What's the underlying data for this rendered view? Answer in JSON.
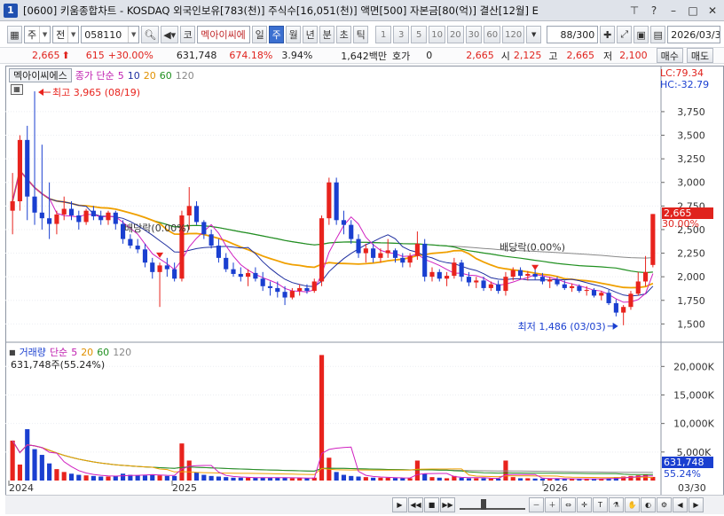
{
  "window": {
    "number": "1",
    "title": "[0600] 키움종합차트 - KOSDAQ 외국인보유[783(천)] 주식수[16,051(천)] 액면[500] 자본금[80(억)] 결산[12월] E"
  },
  "toolbar": {
    "period_select": "주",
    "prev_select": "전",
    "stock_code": "058110",
    "market_btn": "코",
    "stock_name": "멕아이씨에",
    "periods": [
      "일",
      "주",
      "월",
      "년",
      "분",
      "초",
      "틱"
    ],
    "active_period": "주",
    "intervals": [
      "1",
      "3",
      "5",
      "10",
      "20",
      "30",
      "60",
      "120"
    ],
    "count": "88/300",
    "date": "2026/03/3"
  },
  "quote": {
    "price": "2,665",
    "change": "615",
    "change_pct": "+30.00%",
    "volume": "631,748",
    "volume_pct": "674.18%",
    "turnover": "3.94%",
    "amount": "1,642백만",
    "hoga_label": "호가",
    "hoga_value": "0",
    "last": "2,665",
    "open_label": "시",
    "open": "2,125",
    "high_label": "고",
    "high": "2,665",
    "low_label": "저",
    "low": "2,100",
    "buy_btn": "매수",
    "sell_btn": "매도"
  },
  "price_panel": {
    "legend_name": "멕아이씨에스",
    "legend_ma": "종가 단순",
    "ma_periods": [
      "5",
      "10",
      "20",
      "60",
      "120"
    ],
    "lc": "LC:79.34",
    "hc": "HC:-32.79",
    "current_price_tag": "2,665",
    "current_pct_tag": "30.00%",
    "high_annot": "최고 3,965 (08/19)",
    "low_annot": "최저 1,486 (03/03)",
    "div_annot_1": "배당락(0.00%)",
    "div_annot_2": "배당락(0.00%)"
  },
  "volume_panel": {
    "legend_name": "거래량",
    "legend_ma": "단순",
    "ma_periods": [
      "5",
      "20",
      "60",
      "120"
    ],
    "volume_text": "631,748주(55.24%)",
    "current_vol_tag": "631,748",
    "current_vol_pct": "55.24%"
  },
  "x_labels": [
    "2024",
    "2025",
    "2026",
    "03/30"
  ],
  "colors": {
    "up": "#e8231d",
    "down": "#1a3fd0",
    "ma5": "#d020c0",
    "ma10": "#2030a0",
    "ma20": "#f0a000",
    "ma60": "#209020",
    "ma120": "#888888"
  },
  "chart_data": {
    "type": "candlestick",
    "price_axis": {
      "ticks": [
        "3,750",
        "3,500",
        "3,250",
        "3,000",
        "2,750",
        "2,500",
        "2,250",
        "2,000",
        "1,750",
        "1,500"
      ],
      "range": [
        1400,
        4050
      ]
    },
    "volume_axis": {
      "ticks": [
        "20,000K",
        "15,000K",
        "10,000K",
        "5,000K"
      ],
      "range": [
        0,
        23000
      ]
    },
    "candles": [
      [
        2700,
        3100,
        2450,
        2800,
        7000
      ],
      [
        2800,
        3500,
        2700,
        3450,
        2800
      ],
      [
        3450,
        3600,
        2600,
        2850,
        9000
      ],
      [
        2850,
        3965,
        2550,
        2680,
        5500
      ],
      [
        2680,
        3400,
        2500,
        2620,
        4500
      ],
      [
        2620,
        3000,
        2400,
        2560,
        3000
      ],
      [
        2560,
        2700,
        2450,
        2660,
        2000
      ],
      [
        2660,
        2850,
        2600,
        2720,
        1500
      ],
      [
        2720,
        2800,
        2600,
        2650,
        1200
      ],
      [
        2650,
        2700,
        2500,
        2580,
        1000
      ],
      [
        2580,
        2720,
        2550,
        2700,
        900
      ],
      [
        2700,
        2750,
        2600,
        2640,
        800
      ],
      [
        2640,
        2700,
        2550,
        2600,
        700
      ],
      [
        2600,
        2700,
        2550,
        2680,
        700
      ],
      [
        2680,
        2700,
        2500,
        2560,
        800
      ],
      [
        2560,
        2600,
        2350,
        2400,
        1200
      ],
      [
        2400,
        2450,
        2300,
        2330,
        1000
      ],
      [
        2330,
        2400,
        2250,
        2290,
        900
      ],
      [
        2290,
        2350,
        2100,
        2150,
        900
      ],
      [
        2150,
        2200,
        1980,
        2050,
        1100
      ],
      [
        2050,
        2150,
        1680,
        2120,
        900
      ],
      [
        2120,
        2200,
        2000,
        2080,
        800
      ],
      [
        2080,
        2150,
        1950,
        1980,
        800
      ],
      [
        1980,
        2700,
        1950,
        2650,
        6500
      ],
      [
        2650,
        2950,
        2500,
        2750,
        3500
      ],
      [
        2750,
        2800,
        2550,
        2580,
        1400
      ],
      [
        2580,
        2600,
        2400,
        2450,
        1000
      ],
      [
        2450,
        2500,
        2300,
        2330,
        800
      ],
      [
        2330,
        2400,
        2150,
        2200,
        700
      ],
      [
        2200,
        2250,
        2050,
        2080,
        600
      ],
      [
        2080,
        2150,
        2000,
        2030,
        500
      ],
      [
        2030,
        2100,
        1950,
        2000,
        500
      ],
      [
        2000,
        2080,
        1900,
        2040,
        500
      ],
      [
        2040,
        2100,
        1950,
        1980,
        500
      ],
      [
        1980,
        2050,
        1850,
        1900,
        500
      ],
      [
        1900,
        1950,
        1800,
        1880,
        500
      ],
      [
        1880,
        1950,
        1780,
        1840,
        500
      ],
      [
        1840,
        1900,
        1700,
        1780,
        500
      ],
      [
        1780,
        1880,
        1760,
        1850,
        400
      ],
      [
        1850,
        1920,
        1800,
        1880,
        400
      ],
      [
        1880,
        1920,
        1820,
        1850,
        400
      ],
      [
        1850,
        1980,
        1830,
        1950,
        500
      ],
      [
        1950,
        2650,
        1900,
        2620,
        22000
      ],
      [
        2620,
        3050,
        2550,
        3000,
        4000
      ],
      [
        3000,
        3050,
        2550,
        2600,
        1500
      ],
      [
        2600,
        2700,
        2450,
        2550,
        1000
      ],
      [
        2550,
        2600,
        2350,
        2400,
        800
      ],
      [
        2400,
        2450,
        2200,
        2250,
        700
      ],
      [
        2250,
        2350,
        2150,
        2300,
        600
      ],
      [
        2300,
        2350,
        2150,
        2200,
        500
      ],
      [
        2200,
        2300,
        2150,
        2250,
        500
      ],
      [
        2250,
        2400,
        2200,
        2280,
        500
      ],
      [
        2280,
        2300,
        2150,
        2200,
        450
      ],
      [
        2200,
        2250,
        2100,
        2150,
        400
      ],
      [
        2150,
        2250,
        2100,
        2220,
        400
      ],
      [
        2220,
        2480,
        2180,
        2350,
        3500
      ],
      [
        2350,
        2400,
        1950,
        2000,
        1200
      ],
      [
        2000,
        2100,
        1950,
        2050,
        600
      ],
      [
        2050,
        2080,
        1950,
        1980,
        500
      ],
      [
        1980,
        2050,
        1900,
        2010,
        400
      ],
      [
        2010,
        2200,
        1980,
        2150,
        800
      ],
      [
        2150,
        2180,
        1950,
        2000,
        500
      ],
      [
        2000,
        2050,
        1900,
        1940,
        400
      ],
      [
        1940,
        2000,
        1880,
        1960,
        400
      ],
      [
        1960,
        2000,
        1850,
        1880,
        400
      ],
      [
        1880,
        1950,
        1850,
        1920,
        350
      ],
      [
        1920,
        1960,
        1820,
        1850,
        350
      ],
      [
        1850,
        2050,
        1800,
        2000,
        3500
      ],
      [
        2000,
        2100,
        1960,
        2070,
        600
      ],
      [
        2070,
        2100,
        1980,
        2010,
        400
      ],
      [
        2010,
        2060,
        1960,
        2030,
        400
      ],
      [
        2030,
        2080,
        1970,
        2000,
        350
      ],
      [
        2000,
        2040,
        1920,
        1950,
        350
      ],
      [
        1950,
        2000,
        1880,
        1970,
        300
      ],
      [
        1970,
        2000,
        1900,
        1920,
        300
      ],
      [
        1920,
        1960,
        1860,
        1880,
        300
      ],
      [
        1880,
        1930,
        1840,
        1900,
        300
      ],
      [
        1900,
        1920,
        1830,
        1850,
        300
      ],
      [
        1850,
        1900,
        1800,
        1860,
        300
      ],
      [
        1860,
        1880,
        1780,
        1800,
        300
      ],
      [
        1800,
        1850,
        1750,
        1830,
        300
      ],
      [
        1830,
        1860,
        1700,
        1720,
        400
      ],
      [
        1720,
        1760,
        1580,
        1620,
        600
      ],
      [
        1620,
        1700,
        1486,
        1680,
        700
      ],
      [
        1680,
        1850,
        1650,
        1820,
        800
      ],
      [
        1820,
        2050,
        1800,
        1950,
        900
      ],
      [
        1950,
        2220,
        1900,
        2050,
        1000
      ],
      [
        2125,
        2665,
        2100,
        2665,
        631
      ]
    ]
  }
}
